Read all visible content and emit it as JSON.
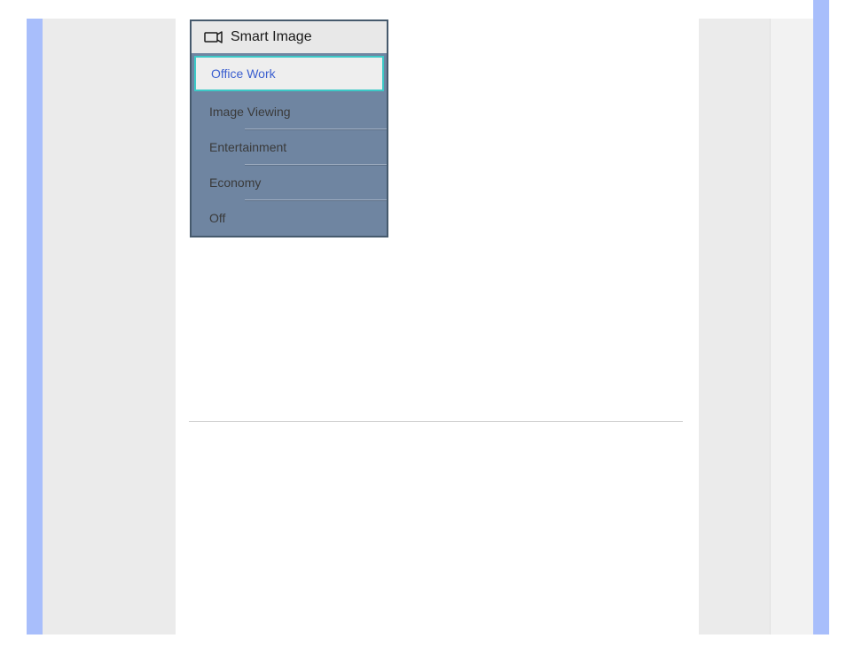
{
  "menu": {
    "title": "Smart Image",
    "items": [
      {
        "label": "Office Work",
        "selected": true
      },
      {
        "label": "Image Viewing",
        "selected": false
      },
      {
        "label": "Entertainment",
        "selected": false
      },
      {
        "label": "Economy",
        "selected": false
      },
      {
        "label": "Off",
        "selected": false
      }
    ]
  }
}
